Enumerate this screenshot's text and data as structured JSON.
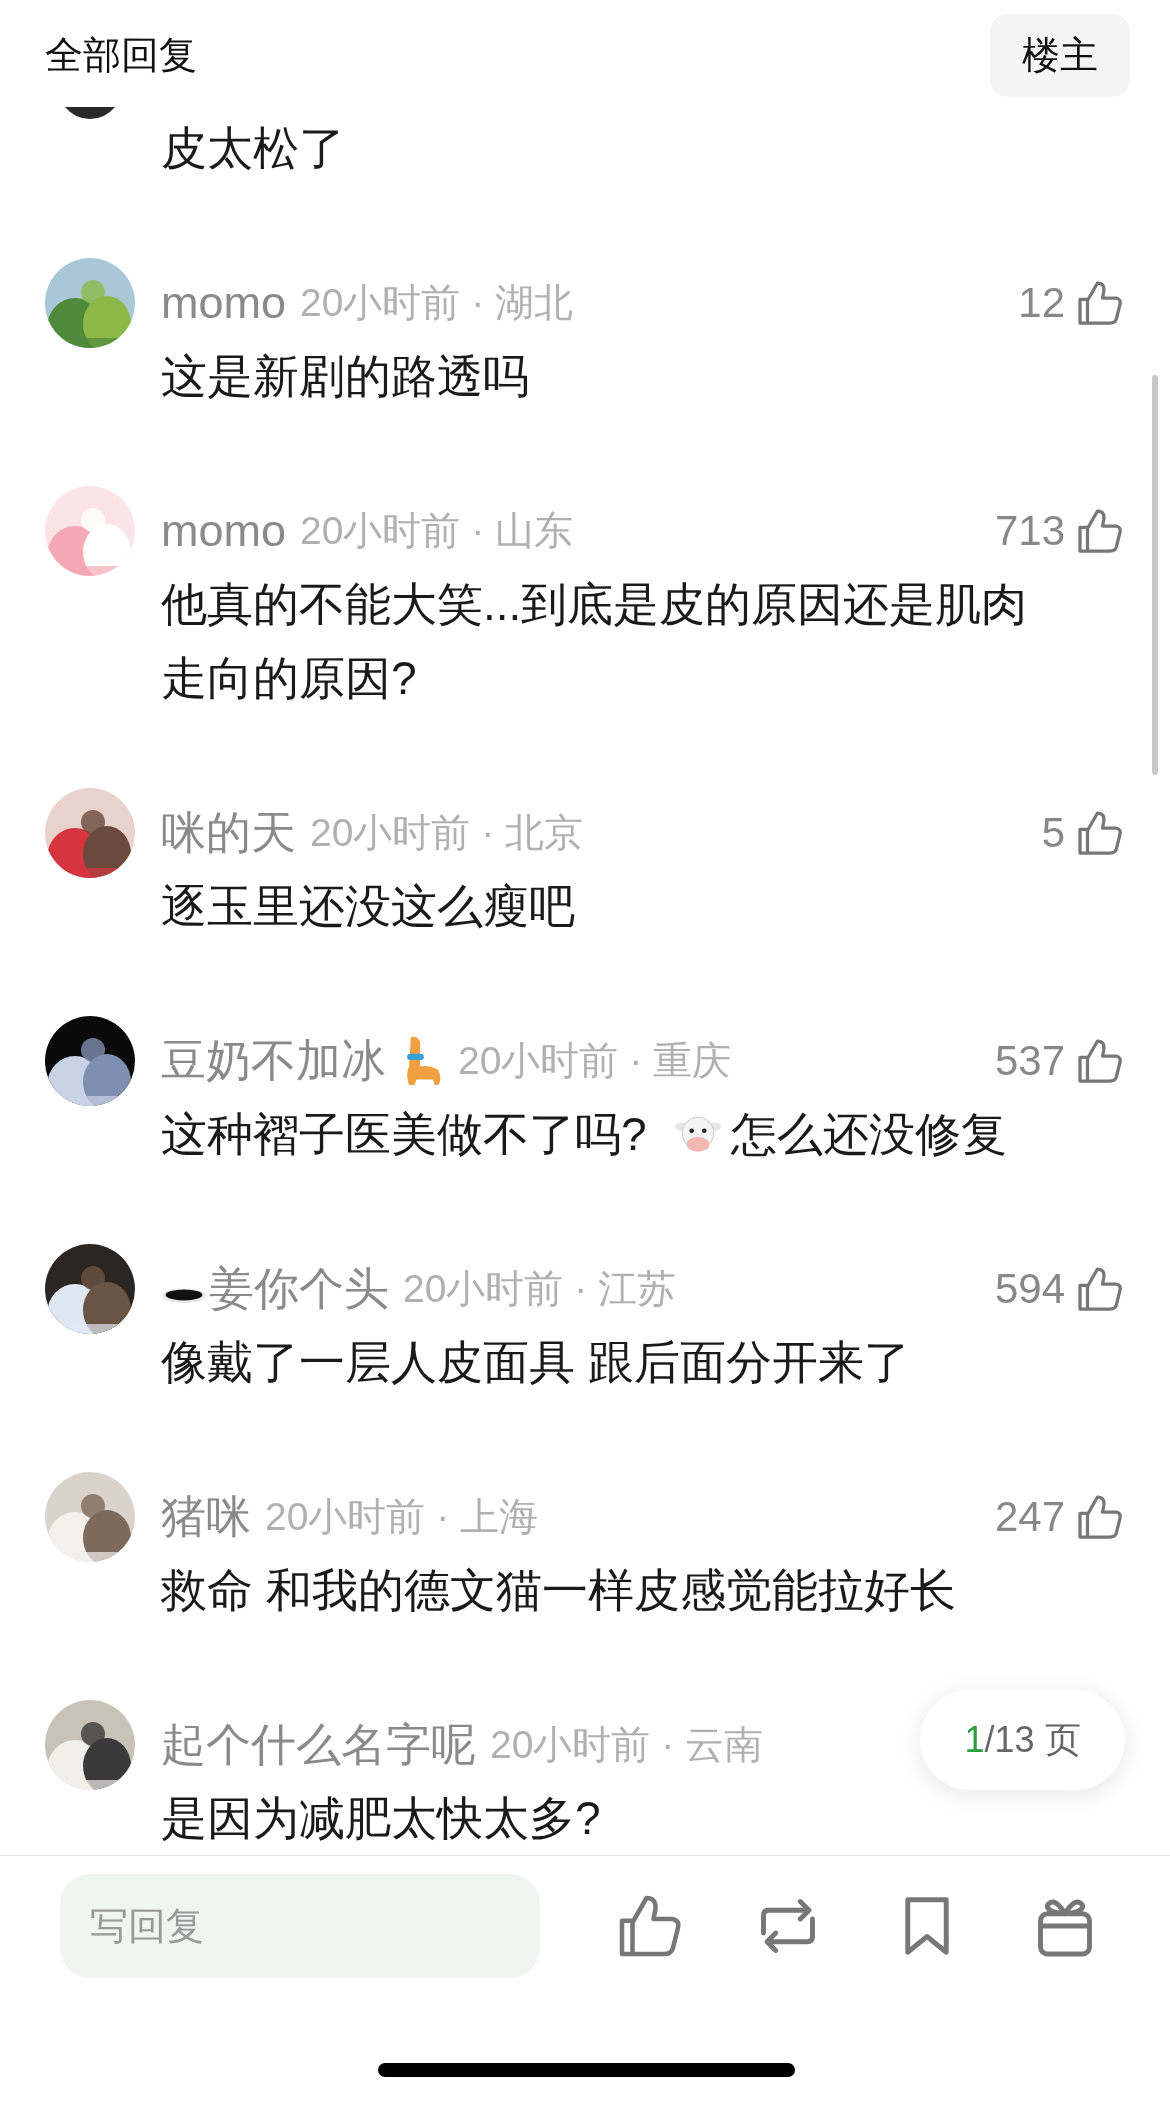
{
  "header": {
    "title": "全部回复",
    "filter_button": "楼主"
  },
  "comments": [
    {
      "segments": [
        {
          "kind": "text",
          "text": "皮太松了"
        }
      ]
    },
    {
      "name": "momo",
      "meta": "20小时前 · 湖北",
      "likes": "12",
      "segments": [
        {
          "kind": "text",
          "text": "这是新剧的路透吗"
        }
      ]
    },
    {
      "name": "momo",
      "meta": "20小时前 · 山东",
      "likes": "713",
      "segments": [
        {
          "kind": "text",
          "text": "他真的不能大笑...到底是皮的原因还是肌肉走向的原因?"
        }
      ]
    },
    {
      "name": "咪的天",
      "meta": "20小时前 · 北京",
      "likes": "5",
      "segments": [
        {
          "kind": "text",
          "text": "逐玉里还没这么瘦吧"
        }
      ]
    },
    {
      "name": "豆奶不加冰",
      "name_suffix_icon": {
        "kind": "alpaca"
      },
      "meta": "20小时前 · 重庆",
      "likes": "537",
      "segments": [
        {
          "kind": "text",
          "text": "这种褶子医美做不了吗?"
        },
        {
          "kind": "cow_emoji"
        },
        {
          "kind": "text",
          "text": "怎么还没修复"
        }
      ]
    },
    {
      "name": "姜你个头",
      "name_prefix_icon": {
        "kind": "hole"
      },
      "meta": "20小时前 · 江苏",
      "likes": "594",
      "segments": [
        {
          "kind": "text",
          "text": "像戴了一层人皮面具 跟后面分开来了"
        }
      ]
    },
    {
      "name": "猪咪",
      "meta": "20小时前 · 上海",
      "likes": "247",
      "segments": [
        {
          "kind": "text",
          "text": "救命 和我的德文猫一样皮感觉能拉好长"
        }
      ]
    },
    {
      "name": "起个什么名字呢",
      "meta": "20小时前 · 云南",
      "segments": [
        {
          "kind": "text",
          "text": "是因为减肥太快太多?"
        }
      ]
    }
  ],
  "pager": {
    "current": "1",
    "rest": "/13 页"
  },
  "reply_field": {
    "placeholder": "写回复"
  }
}
